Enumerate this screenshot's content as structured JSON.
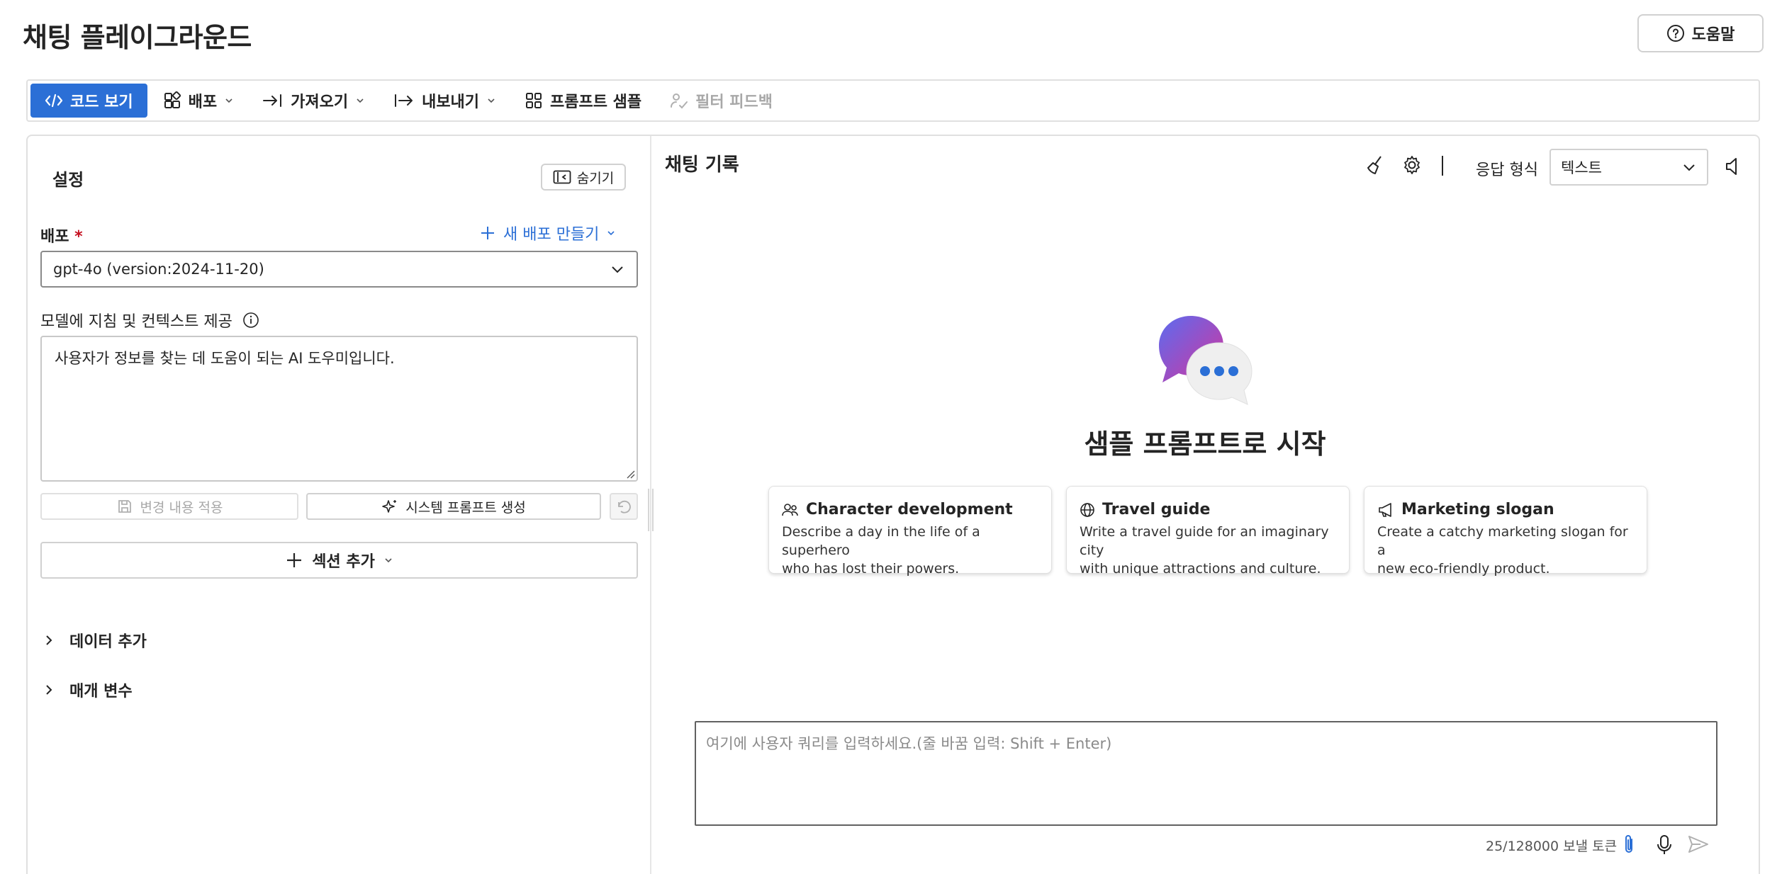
{
  "page": {
    "title": "채팅 플레이그라운드",
    "help_label": "도움말"
  },
  "toolbar": {
    "view_code": "코드 보기",
    "deploy": "배포",
    "import": "가져오기",
    "export": "내보내기",
    "prompt_samples": "프롬프트 샘플",
    "filter_feedback": "필터 피드백"
  },
  "settings": {
    "title": "설정",
    "hide_label": "숨기기",
    "deployment_label": "배포",
    "required_mark": "*",
    "new_deployment_label": "새 배포 만들기",
    "deployment_value": "gpt-4o (version:2024-11-20)",
    "instructions_label": "모델에 지침 및 컨텍스트 제공",
    "instructions_value": "사용자가 정보를 찾는 데 도움이 되는 AI 도우미입니다.",
    "apply_changes": "변경 내용 적용",
    "generate_system_prompt": "시스템 프롬프트 생성",
    "add_section": "섹션 추가",
    "accordions": [
      "데이터 추가",
      "매개 변수"
    ]
  },
  "chat": {
    "title": "채팅 기록",
    "response_format_label": "응답 형식",
    "response_format_value": "텍스트",
    "separator": "|",
    "hero_title": "샘플 프롬프트로 시작",
    "samples": [
      {
        "icon": "people-icon",
        "title": "Character development",
        "desc_line1": "Describe a day in the life of a superhero",
        "desc_line2": "who has lost their powers."
      },
      {
        "icon": "globe-icon",
        "title": "Travel guide",
        "desc_line1": "Write a travel guide for an imaginary city",
        "desc_line2": "with unique attractions and culture."
      },
      {
        "icon": "megaphone-icon",
        "title": "Marketing slogan",
        "desc_line1": "Create a catchy marketing slogan for a",
        "desc_line2": "new eco-friendly product."
      }
    ],
    "query_placeholder": "여기에 사용자 쿼리를 입력하세요.(줄 바꿈 입력: Shift + Enter)",
    "token_count": "25/128000 보낼 토큰"
  },
  "colors": {
    "accent": "#2b6fd6",
    "required": "#c50f1f",
    "disabled": "#a8a8a8"
  }
}
